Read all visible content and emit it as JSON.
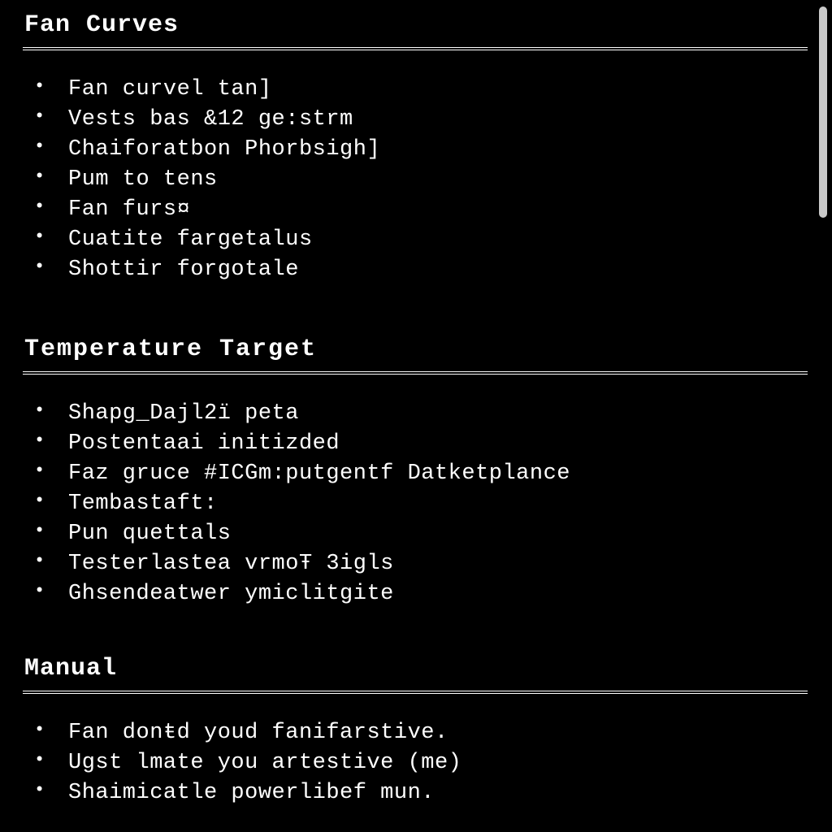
{
  "sections": {
    "fan_curves": {
      "title": "Fan Curves",
      "items": [
        "Fan curvel tan]",
        "Vests bas &12 ge:strm",
        "Chaiforatbon Phorbsigh]",
        "Pum to tens",
        "Fan furs¤",
        "Cuatite fargetalus",
        "Shottir forgotale"
      ]
    },
    "temperature_target": {
      "title": "Temperature Target",
      "items": [
        "Shapg_Dajl2ï peta",
        "Postentaai initizded",
        "Faz gruce #ICGm:putgentf Datketplance",
        "Tembastaft:",
        "Pun quettals",
        "Testerlastea vrmoŦ 3igls",
        "Ghsendeatwer ymiclitgite"
      ]
    },
    "manual": {
      "title": "Manual",
      "items": [
        "Fan donŧd youd fanifarstive.",
        "Ugst lmate you artestive (me)",
        "Shaimicatle powerlibef mun."
      ]
    }
  }
}
